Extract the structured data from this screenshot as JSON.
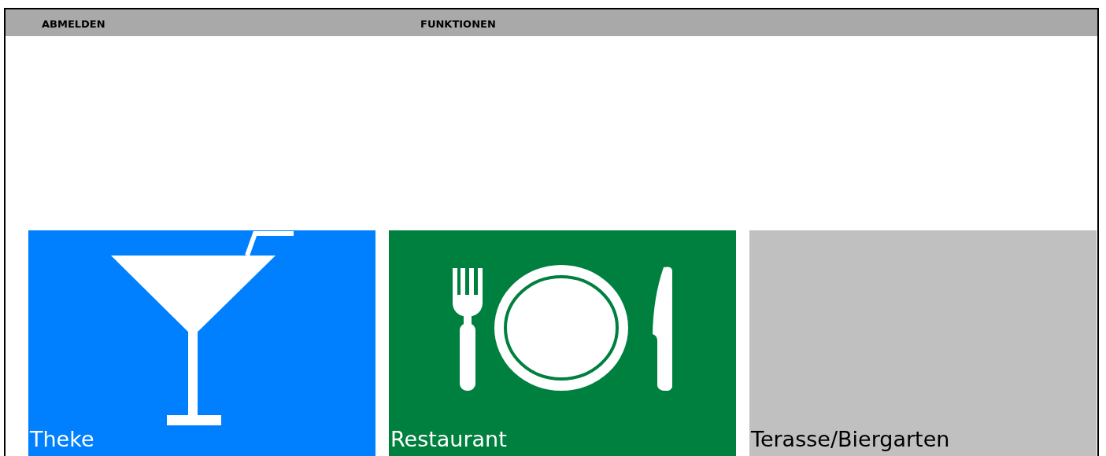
{
  "top_bar": {
    "items": [
      {
        "label": "ABMELDEN"
      },
      {
        "label": "FUNKTIONEN"
      }
    ]
  },
  "tiles": [
    {
      "label": "Theke",
      "color": "#0080ff",
      "kind": "cocktail"
    },
    {
      "label": "Restaurant",
      "color": "#00803e",
      "kind": "dining"
    },
    {
      "label": "Terasse/Biergarten",
      "color": "#c0c0c0",
      "kind": "none"
    }
  ]
}
